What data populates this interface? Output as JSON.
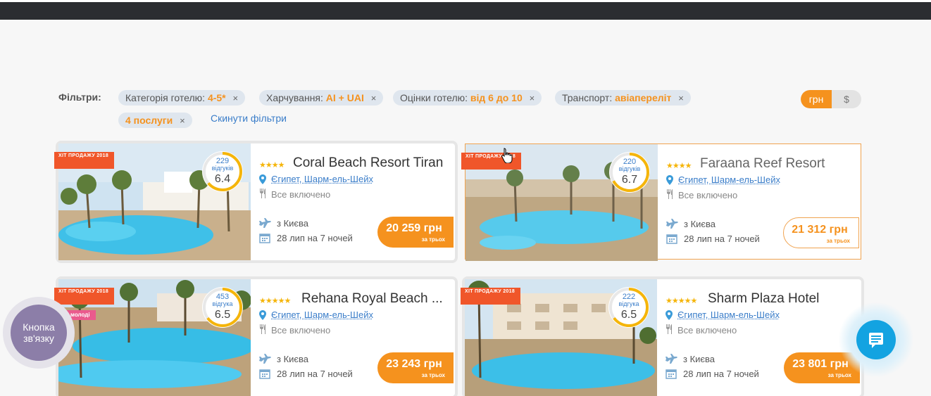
{
  "filters": {
    "label": "Фільтри:",
    "chips": [
      {
        "name": "Категорія готелю:",
        "value": "4-5*"
      },
      {
        "name": "Харчування:",
        "value": "AI + UAI"
      },
      {
        "name": "Оцінки готелю:",
        "value": "від 6 до 10"
      },
      {
        "name": "Транспорт:",
        "value": "авіапереліт"
      },
      {
        "name": "",
        "value": "4 послуги"
      }
    ],
    "close_glyph": "×",
    "reset_label": "Скинути фільтри"
  },
  "currency": {
    "uah": "грн",
    "usd": "$",
    "active": "грн"
  },
  "hotels": [
    {
      "badge": "ХІТ ПРОДАЖУ 2018",
      "badge2": "",
      "reviews_count": "229",
      "reviews_label": "відгуків",
      "score": "6.4",
      "score_fraction": 0.64,
      "stars": "★★★★",
      "name": "Coral Beach Resort Tiran",
      "location": "Єгипет, Шарм-ель-Шейх",
      "meal": "Все включено",
      "from": "з Києва",
      "dates": "28 лип на 7 ночей",
      "price": "20 259 грн",
      "price_note": "за трьох"
    },
    {
      "badge": "ХІТ ПРОДАЖУ 2018",
      "badge2": "",
      "reviews_count": "220",
      "reviews_label": "відгуків",
      "score": "6.7",
      "score_fraction": 0.67,
      "stars": "★★★★",
      "name": "Faraana Reef Resort",
      "location": "Єгипет, Шарм-ель-Шейх",
      "meal": "Все включено",
      "from": "з Києва",
      "dates": "28 лип на 7 ночей",
      "price": "21 312 грн",
      "price_note": "за трьох"
    },
    {
      "badge": "ХІТ ПРОДАЖУ 2018",
      "badge2": "для молоді",
      "reviews_count": "453",
      "reviews_label": "відгука",
      "score": "6.5",
      "score_fraction": 0.65,
      "stars": "★★★★★",
      "name": "Rehana Royal Beach ...",
      "location": "Єгипет, Шарм-ель-Шейх",
      "meal": "Все включено",
      "from": "з Києва",
      "dates": "28 лип на 7 ночей",
      "price": "23 243 грн",
      "price_note": "за трьох"
    },
    {
      "badge": "ХІТ ПРОДАЖУ 2018",
      "badge2": "",
      "reviews_count": "222",
      "reviews_label": "відгука",
      "score": "6.5",
      "score_fraction": 0.65,
      "stars": "★★★★★",
      "name": "Sharm Plaza Hotel",
      "location": "Єгипет, Шарм-ель-Шейх",
      "meal": "Все включено",
      "from": "з Києва",
      "dates": "28 лип на 7 ночей",
      "price": "23 801 грн",
      "price_note": "за трьох"
    }
  ],
  "contact_button": {
    "label": "Кнопка зв'язку"
  },
  "colors": {
    "accent": "#f5921e",
    "link": "#3a7dc9",
    "badge": "#f0562a",
    "chat": "#13a3e1",
    "contact": "#8c7ea8"
  }
}
